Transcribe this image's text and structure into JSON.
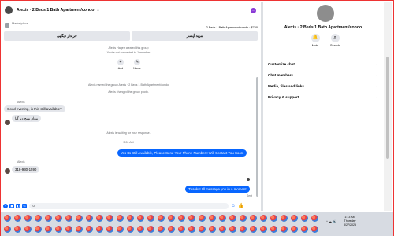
{
  "chat": {
    "title": "Alexis · 2 Beds 1 Bath Apartment/condo",
    "marketplace_label": "Marketplace",
    "listing": "2 Beds 1 Bath Apartment/condo · $750",
    "button_left": "خریدار دیگهی",
    "button_right": "مزید آپشنز",
    "group_created": "Alexis Hagen created this group",
    "not_connected": "You're not connected to 1 member",
    "add_label": "Add",
    "name_label": "Name",
    "named_note": "Alexis named the group Alexis · 2 Beds 1 Bath Apartment/condo",
    "photo_note": "Alexis changed the group photo.",
    "sender1": "Alexis",
    "msg1": "Good evening, is this still available?",
    "msg2": "پیغام بھیج دیا گیا",
    "waiting_note": "Alexis is waiting for your response.",
    "time1": "3:00 AM",
    "reply1": "Yes Its Still Available, Please Send Your Phone Number I Will Contact You Soon.",
    "sender2": "Alexis",
    "msg3": "318-930-1590",
    "reply2": "Thanks! I'll message you in a moment",
    "sent_label": "Sent",
    "composer_placeholder": "Aa",
    "composer_end": "👍"
  },
  "details": {
    "title": "Alexis · 2 Beds 1 Bath Apartment/condo",
    "actions": {
      "mute": "Mute",
      "search": "Search"
    },
    "sections": [
      "Customize chat",
      "Chat members",
      "Media, files and links",
      "Privacy & support"
    ]
  },
  "taskbar": {
    "time": "1:13 AM",
    "day": "Thursday",
    "date": "3/27/2025",
    "tray": "^ ☁ 🔊"
  }
}
